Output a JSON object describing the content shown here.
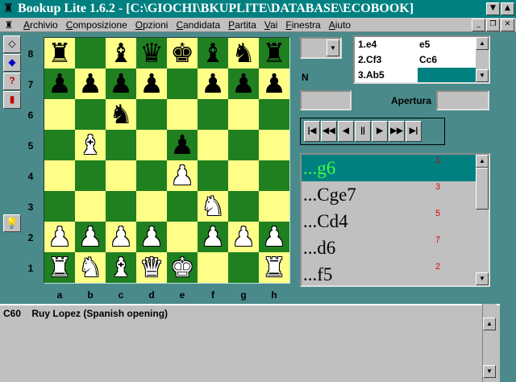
{
  "window": {
    "title": "Bookup Lite 1.6.2 - [C:\\GIOCHI\\BKUPLITE\\DATABASE\\ECOBOOK]"
  },
  "menu": [
    "Archivio",
    "Composizione",
    "Opzioni",
    "Candidata",
    "Partita",
    "Vai",
    "Finestra",
    "Aiuto"
  ],
  "toolbar": {
    "icons": [
      "eraser-icon",
      "eraser-blue-icon",
      "help-icon",
      "book-icon"
    ],
    "bulb": "lightbulb-icon"
  },
  "board": {
    "ranks": [
      "8",
      "7",
      "6",
      "5",
      "4",
      "3",
      "2",
      "1"
    ],
    "files": [
      "a",
      "b",
      "c",
      "d",
      "e",
      "f",
      "g",
      "h"
    ],
    "position": [
      [
        "bR",
        "",
        "bB",
        "bQ",
        "bK",
        "bB",
        "bN",
        "bR"
      ],
      [
        "bP",
        "bP",
        "bP",
        "bP",
        "",
        "bP",
        "bP",
        "bP"
      ],
      [
        "",
        "",
        "bN",
        "",
        "",
        "",
        "",
        ""
      ],
      [
        "",
        "wB",
        "",
        "",
        "bP",
        "",
        "",
        ""
      ],
      [
        "",
        "",
        "",
        "",
        "wP",
        "",
        "",
        ""
      ],
      [
        "",
        "",
        "",
        "",
        "",
        "wN",
        "",
        ""
      ],
      [
        "wP",
        "wP",
        "wP",
        "wP",
        "",
        "wP",
        "wP",
        "wP"
      ],
      [
        "wR",
        "wN",
        "wB",
        "wQ",
        "wK",
        "",
        "",
        "wR"
      ]
    ]
  },
  "side": {
    "n_label": "N",
    "moves": [
      {
        "num": "1.e4",
        "black": "e5"
      },
      {
        "num": "2.Cf3",
        "black": "Cc6"
      },
      {
        "num": "3.Ab5",
        "black": ""
      }
    ],
    "apertura_label": "Apertura",
    "nav": [
      "|◀",
      "◀◀",
      "◀",
      "||",
      "▶",
      "▶▶",
      "▶|"
    ]
  },
  "candidates": [
    {
      "move": "...g6",
      "count": "1"
    },
    {
      "move": "...Cge7",
      "count": "3"
    },
    {
      "move": "...Cd4",
      "count": "5"
    },
    {
      "move": "...d6",
      "count": "7"
    },
    {
      "move": "...f5",
      "count": "2"
    }
  ],
  "info": {
    "eco": "C60",
    "name": "Ruy Lopez (Spanish opening)"
  }
}
